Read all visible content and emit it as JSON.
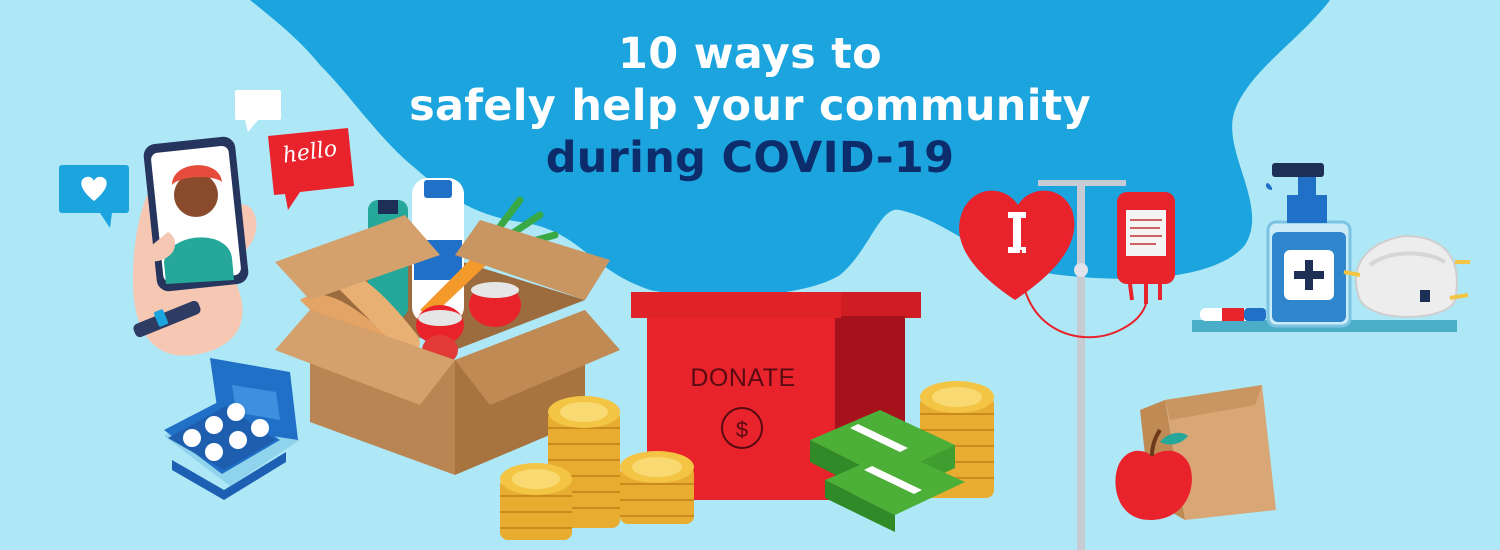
{
  "title": {
    "line1": "10 ways to",
    "line2": "safely help your community",
    "line3": "during COVID-19"
  },
  "donation_box": {
    "label": "DONATE",
    "symbol": "$"
  },
  "chat_bubble": {
    "text": "hello"
  },
  "coin_symbol": "$",
  "colors": {
    "sky_background": "#aee8f7",
    "blob_blue": "#1aa5de",
    "title_white": "#ffffff",
    "title_navy": "#0c2c6c",
    "donate_red": "#e8232b",
    "coin_gold": "#f4c444",
    "cash_green": "#4caf38"
  },
  "icons": [
    "phone-video-call-icon",
    "heart-bubble-icon",
    "hello-bubble-icon",
    "chat-bubble-icon",
    "egg-carton-icon",
    "grocery-box-icon",
    "donate-box-icon",
    "coin-stack-icon",
    "cash-stack-icon",
    "heart-icon",
    "iv-drip-icon",
    "blood-bag-icon",
    "hand-sanitizer-icon",
    "face-mask-icon",
    "thermometer-icon",
    "apple-icon",
    "paper-bag-icon"
  ]
}
